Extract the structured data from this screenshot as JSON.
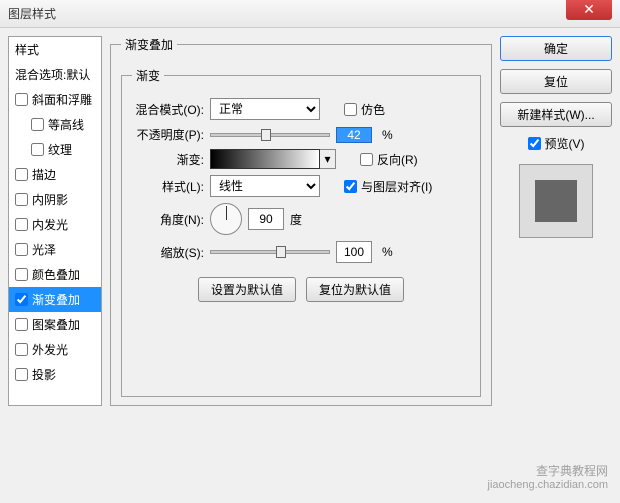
{
  "window": {
    "title": "图层样式"
  },
  "sidebar": {
    "header": "样式",
    "blendDefault": "混合选项:默认",
    "items": [
      {
        "label": "斜面和浮雕",
        "checked": false,
        "indent": false
      },
      {
        "label": "等高线",
        "checked": false,
        "indent": true
      },
      {
        "label": "纹理",
        "checked": false,
        "indent": true
      },
      {
        "label": "描边",
        "checked": false,
        "indent": false
      },
      {
        "label": "内阴影",
        "checked": false,
        "indent": false
      },
      {
        "label": "内发光",
        "checked": false,
        "indent": false
      },
      {
        "label": "光泽",
        "checked": false,
        "indent": false
      },
      {
        "label": "颜色叠加",
        "checked": false,
        "indent": false
      },
      {
        "label": "渐变叠加",
        "checked": true,
        "indent": false,
        "selected": true
      },
      {
        "label": "图案叠加",
        "checked": false,
        "indent": false
      },
      {
        "label": "外发光",
        "checked": false,
        "indent": false
      },
      {
        "label": "投影",
        "checked": false,
        "indent": false
      }
    ]
  },
  "panel": {
    "outerTitle": "渐变叠加",
    "innerTitle": "渐变",
    "blendModeLabel": "混合模式(O):",
    "blendModeValue": "正常",
    "dither": "仿色",
    "opacityLabel": "不透明度(P):",
    "opacityValue": "42",
    "pct": "%",
    "gradientLabel": "渐变:",
    "reverse": "反向(R)",
    "styleLabel": "样式(L):",
    "styleValue": "线性",
    "alignLayer": "与图层对齐(I)",
    "angleLabel": "角度(N):",
    "angleValue": "90",
    "angleUnit": "度",
    "scaleLabel": "缩放(S):",
    "scaleValue": "100",
    "setDefault": "设置为默认值",
    "resetDefault": "复位为默认值"
  },
  "right": {
    "ok": "确定",
    "cancel": "复位",
    "newStyle": "新建样式(W)...",
    "preview": "预览(V)",
    "previewChecked": true
  },
  "watermark": {
    "main": "查字典教程网",
    "sub": "jiaocheng.chazidian.com"
  }
}
